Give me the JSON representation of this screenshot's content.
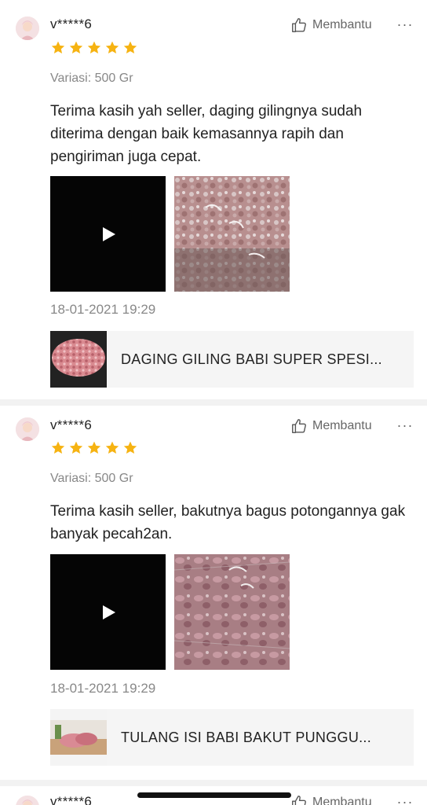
{
  "reviews": [
    {
      "username": "v*****6",
      "rating": 5,
      "helpful_label": "Membantu",
      "more_label": "···",
      "variant": "Variasi: 500 Gr",
      "text": "Terima kasih yah seller, daging gilingnya sudah diterima dengan baik  kemasannya rapih dan pengiriman juga cepat.",
      "date": "18-01-2021 19:29",
      "product_name": "DAGING GILING BABI SUPER SPESI..."
    },
    {
      "username": "v*****6",
      "rating": 5,
      "helpful_label": "Membantu",
      "more_label": "···",
      "variant": "Variasi: 500 Gr",
      "text": "Terima kasih seller, bakutnya bagus potongannya gak banyak pecah2an.",
      "date": "18-01-2021 19:29",
      "product_name": "TULANG ISI BABI BAKUT PUNGGU..."
    },
    {
      "username": "v*****6",
      "helpful_label": "Membantu",
      "more_label": "···"
    }
  ],
  "icons": {
    "avatar": "avatar-icon",
    "helpful": "thumbs-up-icon",
    "more": "more-icon",
    "star": "star-icon",
    "play": "play-icon"
  },
  "colors": {
    "star": "#f6b312",
    "muted_text": "#888888",
    "product_bg": "#f5f5f5"
  }
}
